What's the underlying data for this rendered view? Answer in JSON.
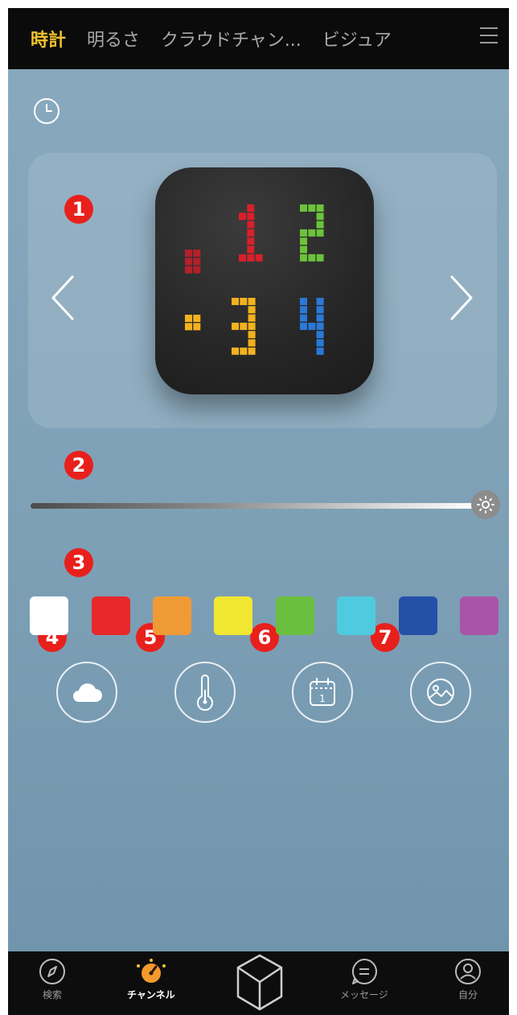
{
  "tabs": [
    {
      "label": "時計",
      "active": true
    },
    {
      "label": "明るさ"
    },
    {
      "label": "クラウドチャン..."
    },
    {
      "label": "ビジュア"
    }
  ],
  "display": {
    "time_top": ".12",
    "time_bottom": ":34",
    "digit_colors": {
      "top_dot": "#b3202a",
      "one": "#d8202a",
      "two": "#6cc23a",
      "bottom_dot": "#f2b21e",
      "three": "#f2b21e",
      "four": "#2a79d8"
    }
  },
  "annotations": [
    "1",
    "2",
    "3",
    "4",
    "5",
    "6",
    "7"
  ],
  "brightness": {
    "level_percent": 100
  },
  "colors": [
    "#ffffff",
    "#e8282b",
    "#f09a35",
    "#f1e632",
    "#6bbf3e",
    "#4ecbdf",
    "#2450a8",
    "#a855a8"
  ],
  "functions": [
    {
      "icon": "cloud-icon"
    },
    {
      "icon": "thermometer-icon"
    },
    {
      "icon": "calendar-icon",
      "day": "1"
    },
    {
      "icon": "image-icon"
    }
  ],
  "bottom_nav": [
    {
      "label": "検索",
      "icon": "compass-icon"
    },
    {
      "label": "チャンネル",
      "icon": "channel-icon",
      "active": true
    },
    {
      "label": "",
      "icon": "cube-icon"
    },
    {
      "label": "メッセージ",
      "icon": "message-icon"
    },
    {
      "label": "自分",
      "icon": "profile-icon"
    }
  ]
}
